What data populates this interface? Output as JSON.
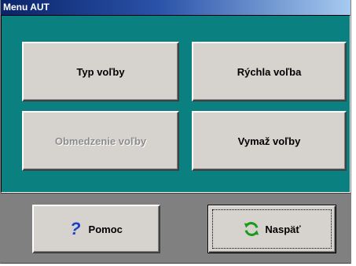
{
  "window": {
    "title": "Menu AUT"
  },
  "buttons": {
    "typ": "Typ voľby",
    "rychla": "Rýchla voľba",
    "obmedzenie": "Obmedzenie voľby",
    "vymaz": "Vymaž voľby",
    "pomoc": "Pomoc",
    "naspat": "Naspäť"
  },
  "icons": {
    "pomoc": "question-mark-icon",
    "naspat": "refresh-arrows-icon"
  },
  "colors": {
    "panel": "#0b8080",
    "titlebar": "#0a246a",
    "button": "#d6d3ce",
    "disabled_text": "#8c8c8c",
    "help_icon": "#1c3fc8",
    "refresh_icon": "#1a9a1a"
  }
}
